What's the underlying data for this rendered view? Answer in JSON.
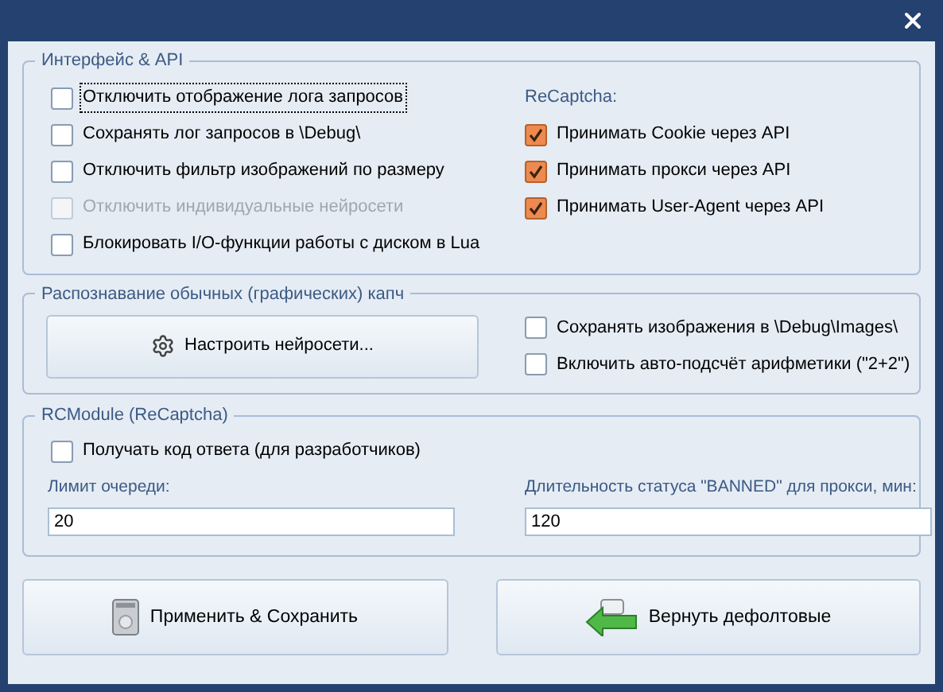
{
  "interface_api": {
    "legend": "Интерфейс & API",
    "options": [
      {
        "label": "Отключить отображение лога запросов",
        "checked": false,
        "disabled": false,
        "focused": true
      },
      {
        "label": "Сохранять лог запросов в \\Debug\\",
        "checked": false,
        "disabled": false,
        "focused": false
      },
      {
        "label": "Отключить фильтр изображений по размеру",
        "checked": false,
        "disabled": false,
        "focused": false
      },
      {
        "label": "Отключить индивидуальные нейросети",
        "checked": false,
        "disabled": true,
        "focused": false
      },
      {
        "label": "Блокировать I/O-функции работы с диском в Lua",
        "checked": false,
        "disabled": false,
        "focused": false
      }
    ],
    "recaptcha": {
      "label": "ReCaptcha:",
      "options": [
        {
          "label": "Принимать Cookie через API",
          "checked": true,
          "disabled": false,
          "focused": false
        },
        {
          "label": "Принимать прокси через API",
          "checked": true,
          "disabled": false,
          "focused": false
        },
        {
          "label": "Принимать User-Agent через API",
          "checked": true,
          "disabled": false,
          "focused": false
        }
      ]
    }
  },
  "captcha_recognition": {
    "legend": "Распознавание обычных (графических) капч",
    "button": "Настроить нейросети...",
    "options": [
      {
        "label": "Сохранять изображения в \\Debug\\Images\\",
        "checked": false,
        "disabled": false,
        "focused": false
      },
      {
        "label": "Включить авто-подсчёт арифметики (\"2+2\")",
        "checked": false,
        "disabled": false,
        "focused": false
      }
    ]
  },
  "rcmodule": {
    "legend": "RCModule (ReCaptcha)",
    "options": [
      {
        "label": "Получать код ответа (для разработчиков)",
        "checked": false,
        "disabled": false,
        "focused": false
      }
    ],
    "fields": [
      {
        "label": "Лимит очереди:",
        "value": "20"
      },
      {
        "label": "Длительность статуса \"BANNED\" для прокси, мин:",
        "value": "120"
      }
    ]
  },
  "buttons": [
    {
      "kind": "save",
      "label": "Применить & Сохранить"
    },
    {
      "kind": "reset",
      "label": "Вернуть дефолтовые"
    }
  ]
}
